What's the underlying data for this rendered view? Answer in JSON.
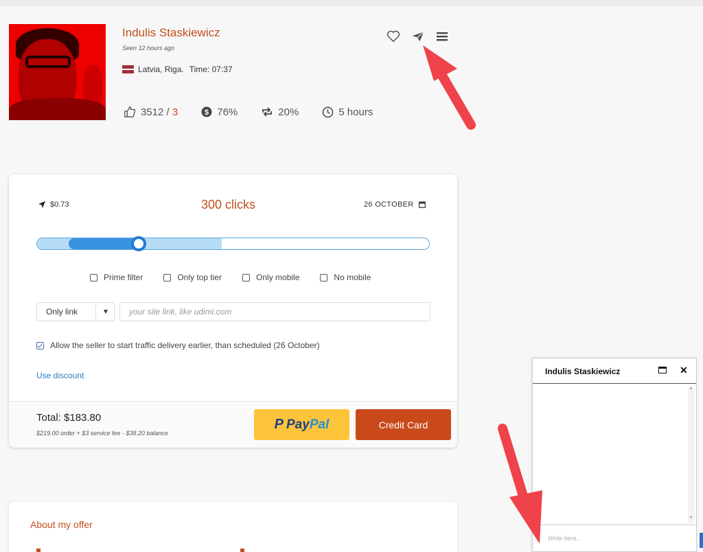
{
  "profile": {
    "name": "Indulis Staskiewicz",
    "seen": "Seen 12 hours ago",
    "location": "Latvia, Riga.",
    "time": "Time: 07:37",
    "stats": {
      "likes": "3512",
      "likes_separator": " / ",
      "dislikes": "3",
      "sales_percent": "76%",
      "repeat_percent": "20%",
      "response_time": "5 hours"
    },
    "icons": [
      "heart-icon",
      "send-icon",
      "menu-icon"
    ]
  },
  "order": {
    "price": "$0.73",
    "clicks": "300 clicks",
    "date": "26 OCTOBER",
    "slider": {
      "min_fraction": 0.08,
      "value_fraction": 0.26,
      "available_fraction": 0.47
    },
    "filters": [
      {
        "label": "Prime filter",
        "checked": false
      },
      {
        "label": "Only top tier",
        "checked": false
      },
      {
        "label": "Only mobile",
        "checked": false
      },
      {
        "label": "No mobile",
        "checked": false
      }
    ],
    "link_type": "Only link",
    "link_placeholder": "your site link, like udimi.com",
    "allow_early": "Allow the seller to start traffic delivery earlier, than scheduled (26 October)",
    "use_discount": "Use discount",
    "total": "Total: $183.80",
    "breakdown": "$219.00 order + $3 service fee - $38.20 balance",
    "paypal_pay": "Pay",
    "paypal_pal": "Pal",
    "credit_card": "Credit Card"
  },
  "about": {
    "title": "About my offer"
  },
  "chat": {
    "name": "Indulis Staskiewicz",
    "placeholder": "Write here..."
  },
  "colors": {
    "accent": "#c0501e",
    "paypal": "#fdc439",
    "credit": "#c9491b",
    "slider": "#3a93e0",
    "arrow": "#f0424a"
  }
}
